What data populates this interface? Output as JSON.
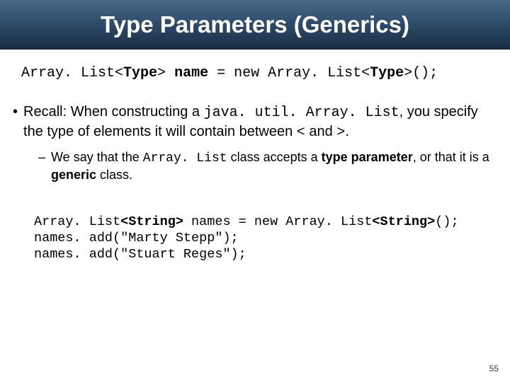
{
  "title": "Type Parameters (Generics)",
  "syntax": {
    "part1": "Array. List<",
    "type1": "Type",
    "part2": "> ",
    "name": "name",
    "part3": " = new Array. List<",
    "type2": "Type",
    "part4": ">();"
  },
  "bullet": {
    "lead": "Recall: When constructing a ",
    "code": "java. util. Array. List",
    "tail1": ", you specify the type of elements it will contain between ",
    "lt": "<",
    "and": " and ",
    "gt": ">",
    "period": "."
  },
  "subbullet": {
    "lead": "We say that the ",
    "code": "Array. List",
    "mid": " class accepts a ",
    "tp": "type parameter",
    "mid2": ", or that it is a ",
    "gc": "generic",
    "tail": " class."
  },
  "code_example": {
    "l1a": "Array. List",
    "l1b": "<String>",
    "l1c": " names = new Array. List",
    "l1d": "<String>",
    "l1e": "();",
    "l2": "names. add(\"Marty Stepp\");",
    "l3": "names. add(\"Stuart Reges\");"
  },
  "page_number": "55"
}
